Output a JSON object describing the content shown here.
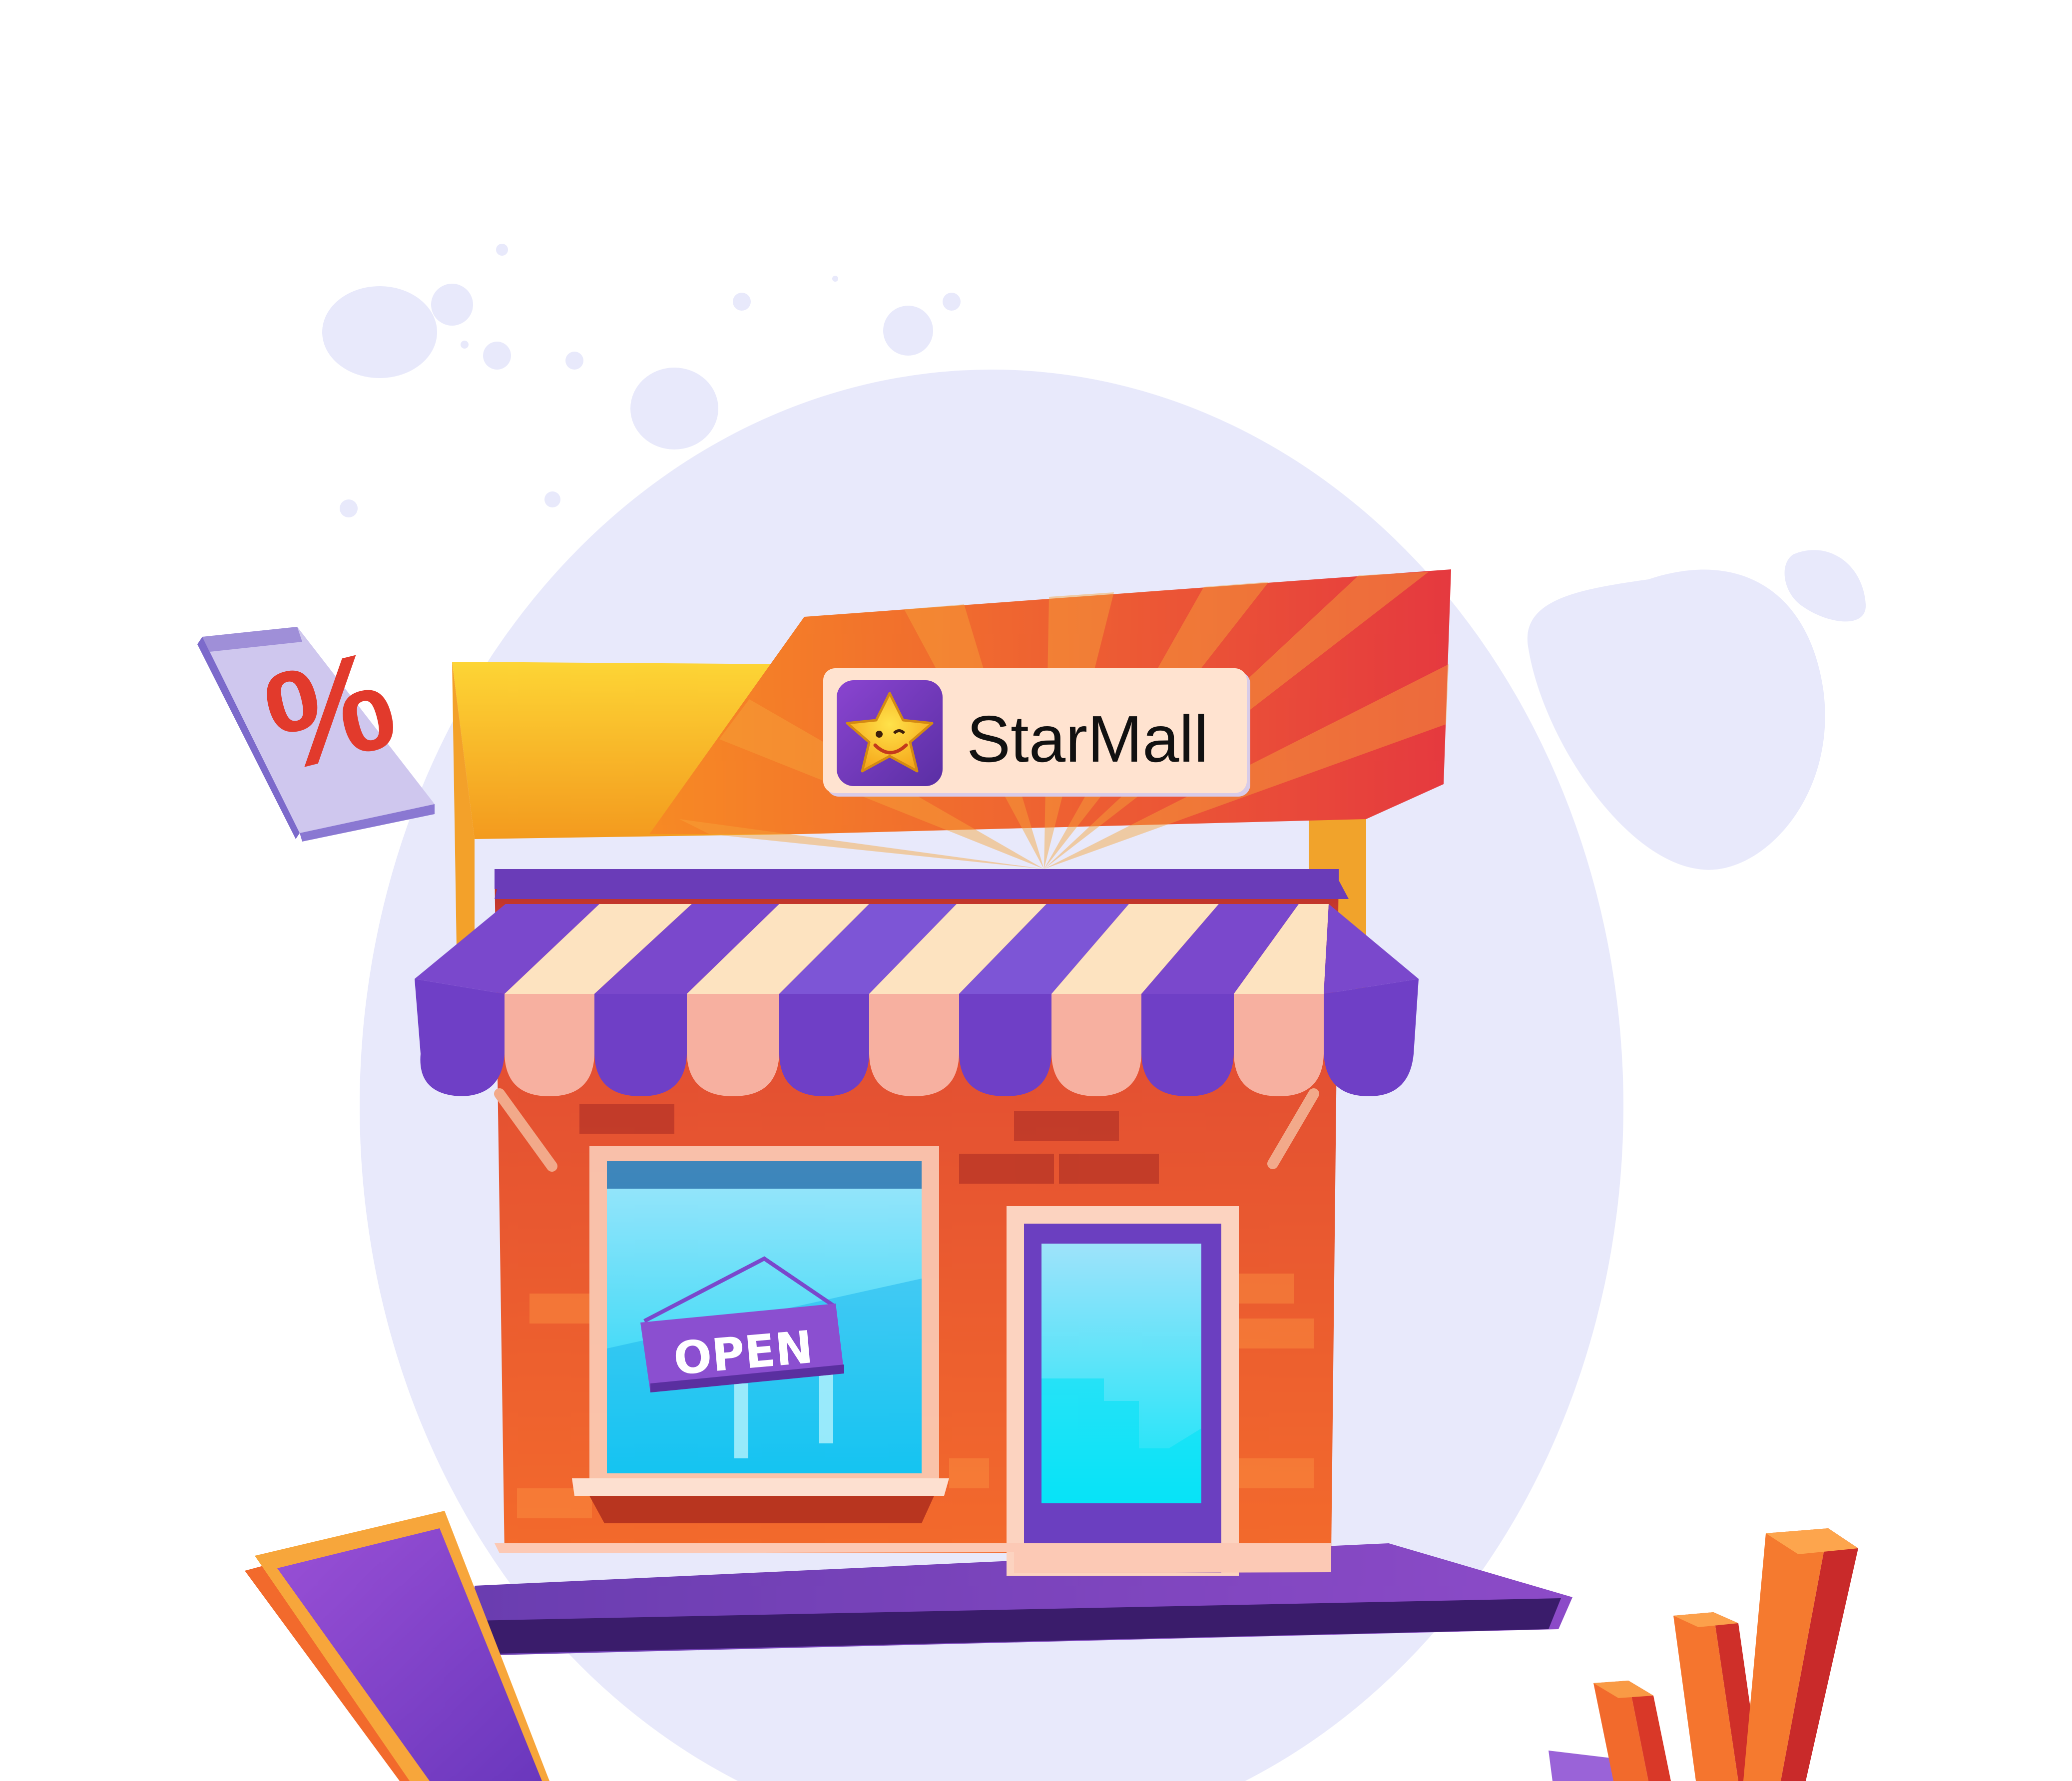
{
  "store": {
    "brand_name": "StarMall",
    "open_sign": "OPEN",
    "discount_symbol": "%"
  },
  "icons": {
    "logo": "smiling-star-logo",
    "discount": "percent-sign-tile",
    "phone": "tilted-phone",
    "chart": "3d-bar-chart"
  },
  "colors": {
    "background": "#ffffff",
    "blob": "#e8e9fb",
    "wall": "#ea5a32",
    "awning_purple": "#7a4cc8",
    "awning_cream": "#fde3c0",
    "sign_board": "#f0602f",
    "side_wall": "#f5b82a",
    "window_glass": "#38c9f5",
    "door": "#6b3fc0",
    "sidewalk": "#5b32a8",
    "logo_tile": "#7a3fc4",
    "star": "#fbc930"
  }
}
